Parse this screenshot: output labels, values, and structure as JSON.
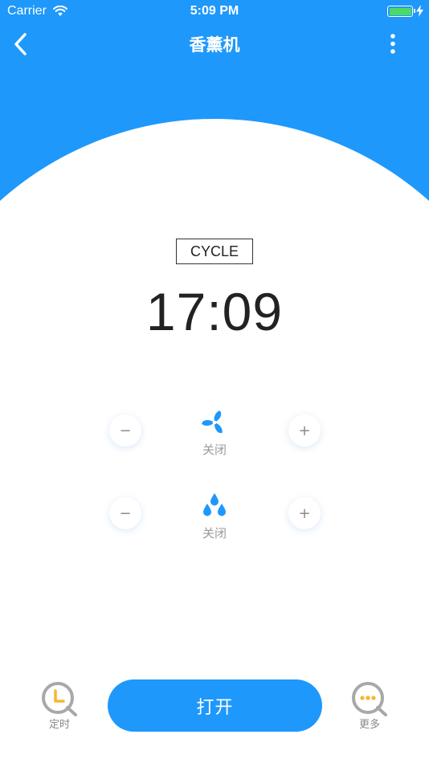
{
  "status_bar": {
    "carrier": "Carrier",
    "time": "5:09 PM",
    "wifi_icon": "wifi-icon",
    "battery_icon": "battery-icon",
    "charging_icon": "bolt-icon"
  },
  "nav": {
    "title": "香薰机",
    "back_icon": "chevron-left-icon",
    "more_icon": "vertical-dots-icon"
  },
  "mode": {
    "label": "CYCLE"
  },
  "clock": {
    "time": "17:09"
  },
  "controls": {
    "fan": {
      "icon": "fan-icon",
      "status": "关闭",
      "decrease_label": "−",
      "increase_label": "+"
    },
    "mist": {
      "icon": "water-drops-icon",
      "status": "关闭",
      "decrease_label": "−",
      "increase_label": "+"
    }
  },
  "bottom_bar": {
    "timer_label": "定时",
    "power_label": "打开",
    "more_label": "更多"
  },
  "colors": {
    "primary": "#1e98fb",
    "timer_accent": "#f5b731",
    "icon_gray": "#a8a8a8",
    "battery_green": "#4cd964"
  }
}
